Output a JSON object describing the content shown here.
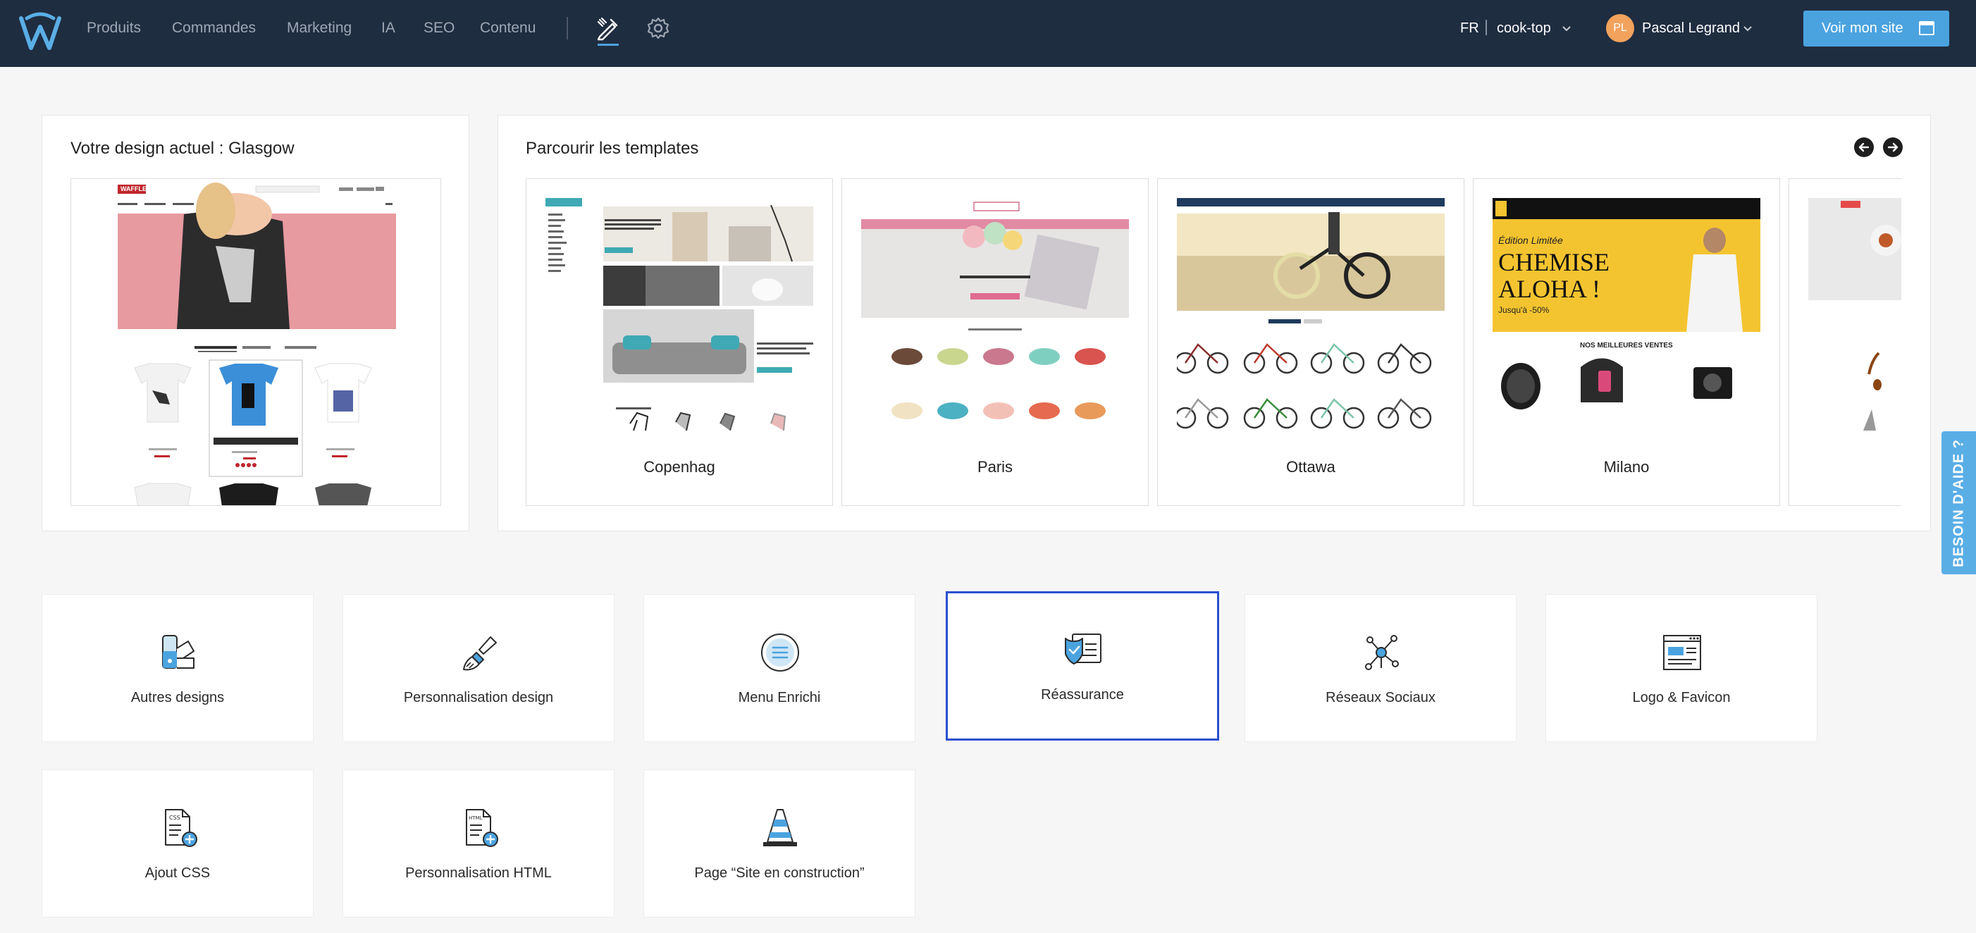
{
  "nav": {
    "items": [
      {
        "label": "Produits"
      },
      {
        "label": "Commandes"
      },
      {
        "label": "Marketing"
      },
      {
        "label": "IA"
      },
      {
        "label": "SEO"
      },
      {
        "label": "Contenu"
      }
    ],
    "lang": "FR",
    "site": "cook-top",
    "user_initials": "PL",
    "user_name": "Pascal Legrand",
    "view_site_label": "Voir mon site"
  },
  "current_design": {
    "title": "Votre design actuel : Glasgow",
    "preview_brand": "WAFFLE"
  },
  "templates": {
    "title": "Parcourir les templates",
    "items": [
      {
        "name": "Copenhag"
      },
      {
        "name": "Paris"
      },
      {
        "name": "Ottawa"
      },
      {
        "name": "Milano",
        "banner_line1": "Édition Limitée",
        "banner_line2": "CHEMISE",
        "banner_line3": "ALOHA !",
        "banner_line4": "Jusqu'à -50%",
        "section": "NOS MEILLEURES VENTES"
      }
    ]
  },
  "tiles": [
    {
      "label": "Autres designs",
      "icon": "palette-icon"
    },
    {
      "label": "Personnalisation design",
      "icon": "brush-icon"
    },
    {
      "label": "Menu Enrichi",
      "icon": "menu-icon"
    },
    {
      "label": "Réassurance",
      "icon": "shield-card-icon"
    },
    {
      "label": "Réseaux Sociaux",
      "icon": "network-icon"
    },
    {
      "label": "Logo & Favicon",
      "icon": "browser-window-icon"
    },
    {
      "label": "Ajout CSS",
      "icon": "css-file-icon"
    },
    {
      "label": "Personnalisation HTML",
      "icon": "html-file-icon"
    },
    {
      "label": "Page “Site en construction”",
      "icon": "traffic-cone-icon"
    }
  ],
  "help": {
    "label": "BESOIN D'AIDE ?"
  },
  "colors": {
    "topbar": "#1f2d40",
    "accent": "#4aa3df",
    "selected_border": "#2b4fcf"
  }
}
